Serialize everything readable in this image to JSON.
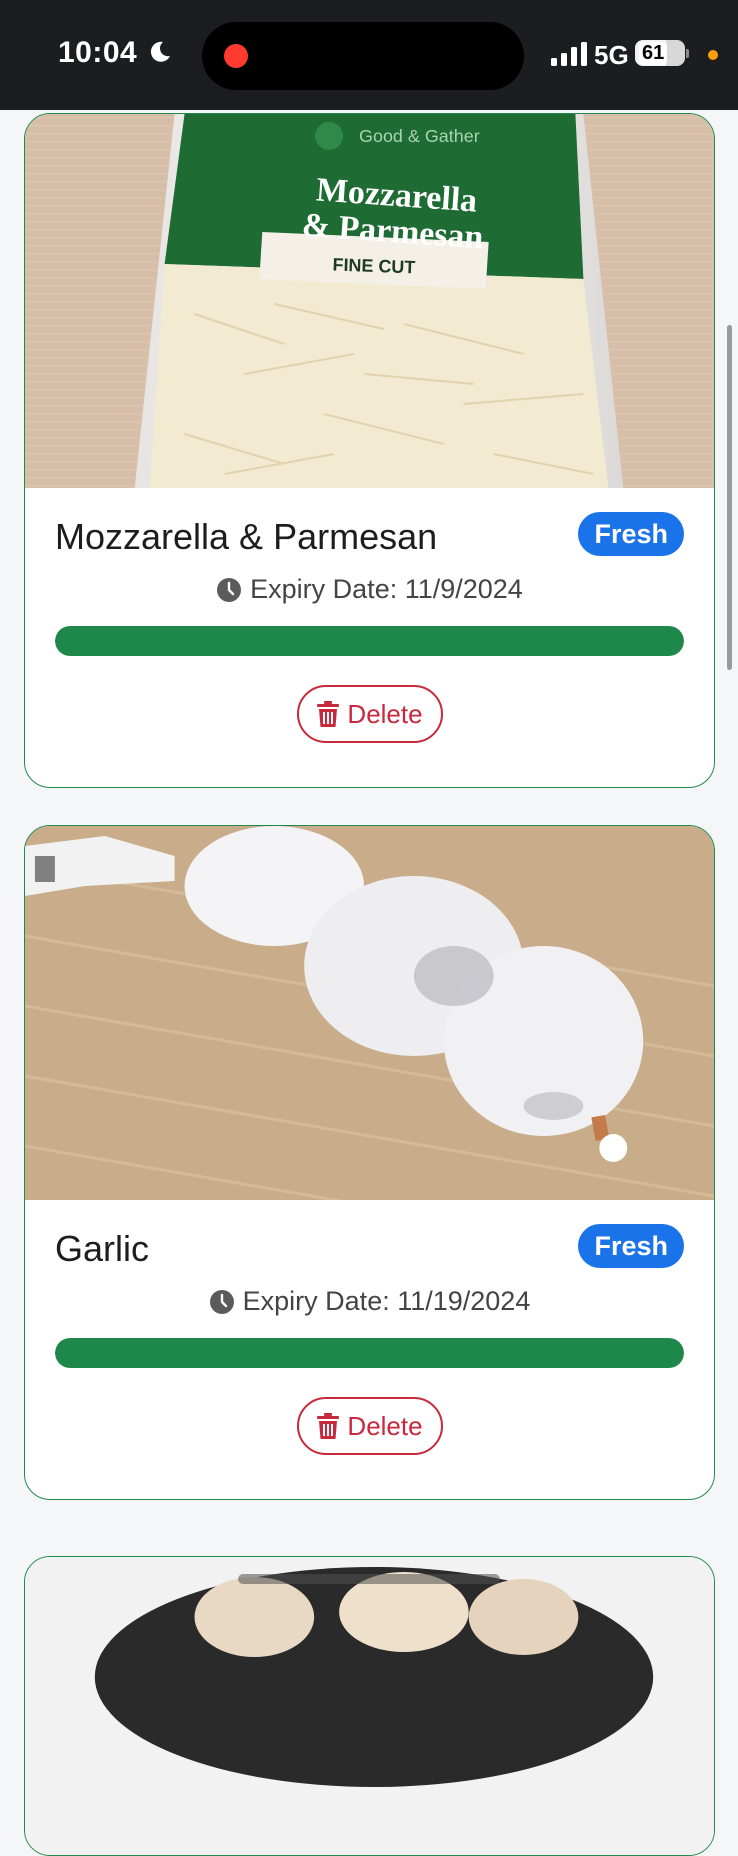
{
  "status_bar": {
    "time": "10:04",
    "network": "5G",
    "battery_percent": "61",
    "battery_level": 0.61
  },
  "items": [
    {
      "name": "Mozzarella & Parmesan",
      "status": "Fresh",
      "expiry_label": "Expiry Date: 11/9/2024",
      "freshness_fraction": 1.0,
      "delete_label": "Delete",
      "photo": {
        "brand": "Good & Gather",
        "product_line1": "Mozzarella",
        "product_line2": "& Parmesan",
        "variant": "FINE CUT"
      }
    },
    {
      "name": "Garlic",
      "status": "Fresh",
      "expiry_label": "Expiry Date: 11/19/2024",
      "freshness_fraction": 1.0,
      "delete_label": "Delete"
    }
  ],
  "colors": {
    "card_border": "#1f8a4c",
    "badge_fresh": "#1a73e8",
    "progress": "#1e874a",
    "delete": "#c8293c"
  }
}
